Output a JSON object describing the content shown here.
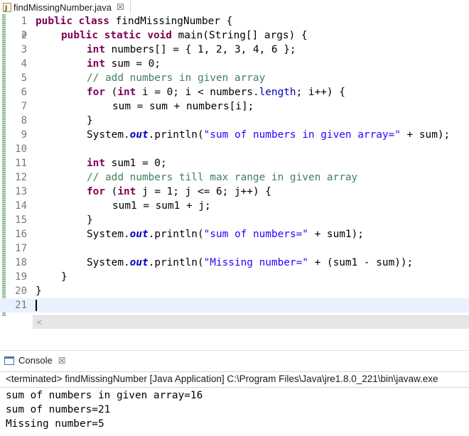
{
  "editor_tab": {
    "title": "findMissingNumber.java",
    "close": "☒"
  },
  "editor": {
    "lines": [
      {
        "n": "1",
        "fold": ""
      },
      {
        "n": "2",
        "fold": "⊖"
      },
      {
        "n": "3",
        "fold": ""
      },
      {
        "n": "4",
        "fold": ""
      },
      {
        "n": "5",
        "fold": ""
      },
      {
        "n": "6",
        "fold": ""
      },
      {
        "n": "7",
        "fold": ""
      },
      {
        "n": "8",
        "fold": ""
      },
      {
        "n": "9",
        "fold": ""
      },
      {
        "n": "10",
        "fold": ""
      },
      {
        "n": "11",
        "fold": ""
      },
      {
        "n": "12",
        "fold": ""
      },
      {
        "n": "13",
        "fold": ""
      },
      {
        "n": "14",
        "fold": ""
      },
      {
        "n": "15",
        "fold": ""
      },
      {
        "n": "16",
        "fold": ""
      },
      {
        "n": "17",
        "fold": ""
      },
      {
        "n": "18",
        "fold": ""
      },
      {
        "n": "19",
        "fold": ""
      },
      {
        "n": "20",
        "fold": ""
      },
      {
        "n": "21",
        "fold": ""
      }
    ],
    "code": {
      "l1_kw1": "public",
      "l1_kw2": "class",
      "l1_rest": " findMissingNumber {",
      "l2_kw1": "public",
      "l2_kw2": "static",
      "l2_kw3": "void",
      "l2_rest": " main(String[] args) {",
      "l3_kw": "int",
      "l3_rest": " numbers[] = { 1, 2, 3, 4, 6 };",
      "l4_kw": "int",
      "l4_rest": " sum = 0;",
      "l5_cm": "// add numbers in given array",
      "l6_kw1": "for",
      "l6_p1": " (",
      "l6_kw2": "int",
      "l6_p2": " i = 0; i < numbers.",
      "l6_fld": "length",
      "l6_p3": "; i++) {",
      "l7": "sum = sum + numbers[i];",
      "l8": "}",
      "l9_p1": "System.",
      "l9_sf": "out",
      "l9_p2": ".println(",
      "l9_str": "\"sum of numbers in given array=\"",
      "l9_p3": " + sum);",
      "l11_kw": "int",
      "l11_rest": " sum1 = 0;",
      "l12_cm": "// add numbers till max range in given array",
      "l13_kw1": "for",
      "l13_p1": " (",
      "l13_kw2": "int",
      "l13_p2": " j = 1; j <= 6; j++) {",
      "l14": "sum1 = sum1 + j;",
      "l15": "}",
      "l16_p1": "System.",
      "l16_sf": "out",
      "l16_p2": ".println(",
      "l16_str": "\"sum of numbers=\"",
      "l16_p3": " + sum1);",
      "l18_p1": "System.",
      "l18_sf": "out",
      "l18_p2": ".println(",
      "l18_str": "\"Missing number=\"",
      "l18_p3": " + (sum1 - sum));",
      "l19": "}",
      "l20": "}"
    }
  },
  "scrollbar": {
    "left_arrow": "<"
  },
  "console": {
    "title": "Console",
    "close": "☒",
    "status": "<terminated> findMissingNumber [Java Application] C:\\Program Files\\Java\\jre1.8.0_221\\bin\\javaw.exe",
    "output": [
      "sum of numbers in given array=16",
      "sum of numbers=21",
      "Missing number=5"
    ]
  }
}
